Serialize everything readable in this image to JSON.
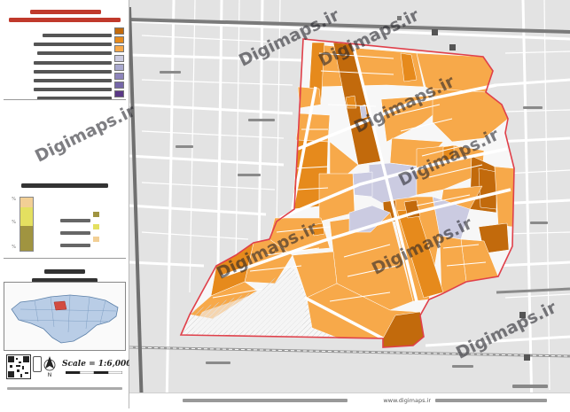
{
  "legend": {
    "title": "",
    "subtitle": "",
    "classes": [
      {
        "label": "",
        "color": "#c26a0c"
      },
      {
        "label": "",
        "color": "#e68a1c"
      },
      {
        "label": "",
        "color": "#f7a94a"
      },
      {
        "label": "",
        "color": "#cbcbe1"
      },
      {
        "label": "",
        "color": "#a9a9cf"
      },
      {
        "label": "",
        "color": "#8d84bb"
      },
      {
        "label": "",
        "color": "#7566a8"
      },
      {
        "label": "",
        "color": "#5a3886"
      }
    ],
    "chart_heading": "",
    "chart_items": [
      {
        "label": "",
        "color": "#a09440"
      },
      {
        "label": "",
        "color": "#e4e060"
      },
      {
        "label": "",
        "color": "#f2cf95"
      }
    ],
    "pct_mark": "%",
    "district_title": "",
    "district_subtitle": "",
    "scale_label": "Scale = 1:6,000",
    "north_label": "N",
    "footer_note": ""
  },
  "map": {
    "watermark": "Digimaps.ir",
    "station_label": "",
    "credits_prefix": "",
    "credits_site": "www.digimaps.ir",
    "credits_suffix": ""
  }
}
